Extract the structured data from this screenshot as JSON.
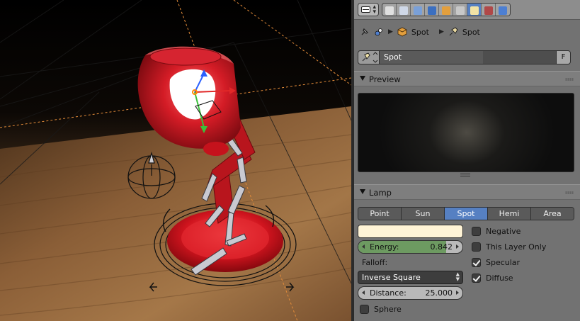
{
  "header": {
    "editor_type_icon": "properties-editor-icon",
    "context_tabs": [
      {
        "name": "render-icon",
        "color": "#e0e0e0",
        "active": false
      },
      {
        "name": "render-layers-icon",
        "color": "#cfd8e8",
        "active": false
      },
      {
        "name": "scene-icon",
        "color": "#7aa0d8",
        "active": false
      },
      {
        "name": "world-icon",
        "color": "#3b6fc0",
        "active": false
      },
      {
        "name": "object-icon",
        "color": "#e39f3d",
        "active": false
      },
      {
        "name": "constraints-icon",
        "color": "#c8c8c8",
        "active": false
      },
      {
        "name": "lamp-data-icon",
        "color": "#f2e3a5",
        "active": true
      },
      {
        "name": "texture-icon",
        "color": "#b04848",
        "active": false
      },
      {
        "name": "physics-icon",
        "color": "#4d7fd2",
        "active": false
      }
    ]
  },
  "breadcrumb": {
    "pin_icon": "pin-icon",
    "scene_icon": "scene-icon",
    "object_label": "Spot",
    "object_icon": "object-cube-icon",
    "data_label": "Spot",
    "data_icon": "spot-lamp-icon"
  },
  "datablock": {
    "name": "Spot",
    "fake_user": "F"
  },
  "preview_panel": {
    "title": "Preview"
  },
  "lamp_panel": {
    "title": "Lamp",
    "types": [
      "Point",
      "Sun",
      "Spot",
      "Hemi",
      "Area"
    ],
    "active_type": "Spot",
    "color": "#fff4d6",
    "energy": {
      "label": "Energy:",
      "value": "0.842",
      "fraction": 0.842
    },
    "falloff_label": "Falloff:",
    "falloff_value": "Inverse Square",
    "distance": {
      "label": "Distance:",
      "value": "25.000"
    },
    "sphere": {
      "label": "Sphere",
      "checked": false
    },
    "negative": {
      "label": "Negative",
      "checked": false
    },
    "this_layer_only": {
      "label": "This Layer Only",
      "checked": false
    },
    "specular": {
      "label": "Specular",
      "checked": true
    },
    "diffuse": {
      "label": "Diffuse",
      "checked": true
    }
  },
  "viewport": {
    "description_free": true,
    "lamp_body_color": "#c8141e",
    "floor_color": "#8a5a32",
    "grid_color": "#e58d3a"
  }
}
